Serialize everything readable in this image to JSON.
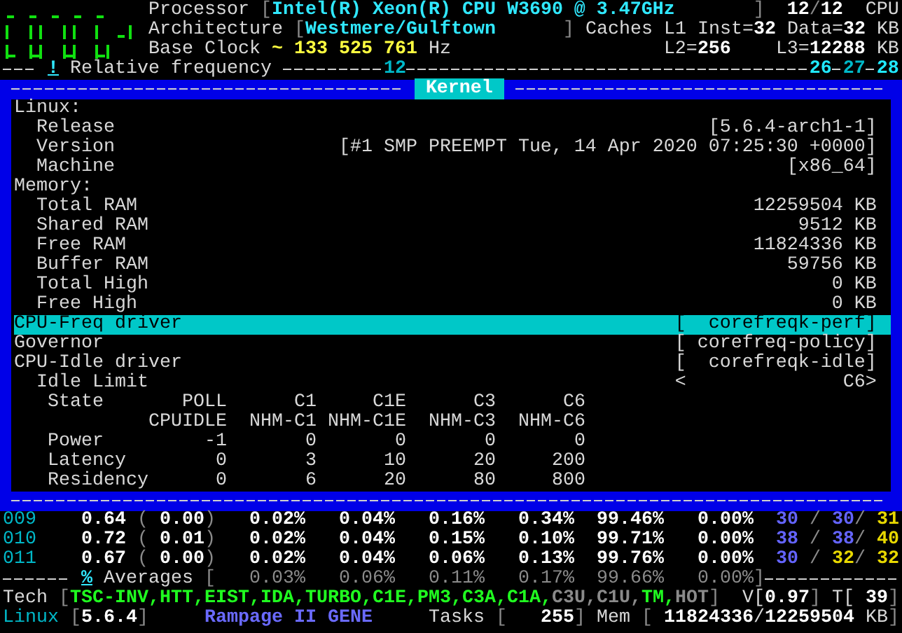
{
  "header": {
    "processor": {
      "label": "Processor",
      "open": "[",
      "value": "Intel(R) Xeon(R) CPU W3690 @ 3.47GHz",
      "close": "]",
      "online": "12",
      "separator": "/",
      "total": "12",
      "unit": "CPU"
    },
    "architecture": {
      "label": "Architecture",
      "open": "[",
      "value": "Westmere/Gulftown",
      "close": "]"
    },
    "caches": {
      "label": "Caches L1",
      "inst_label": "Inst=",
      "inst": "32",
      "data_label": "Data=",
      "data": "32",
      "unit": "KB",
      "l2_label": "L2=",
      "l2": "256",
      "l3_label": "L3=",
      "l3": "12288",
      "l3_unit": "KB"
    },
    "base_clock": {
      "label": "Base Clock",
      "symbol": "~",
      "value": "133 525 761",
      "unit": "Hz"
    },
    "ruler": {
      "symbol": "!",
      "label": "Relative frequency",
      "ticks": [
        {
          "label": "12",
          "color": "#00b8c8"
        },
        {
          "label": "26",
          "color": "#20e8ff"
        },
        {
          "label": "27",
          "color": "#00b8c8"
        },
        {
          "label": "28",
          "color": "#20e8ff"
        }
      ]
    }
  },
  "kernel": {
    "title": "Kernel",
    "rows": [
      {
        "kind": "section",
        "label": "Linux:",
        "selected": false
      },
      {
        "kind": "item",
        "label": "Release",
        "value": "[5.6.4-arch1-1]",
        "selected": false
      },
      {
        "kind": "item",
        "label": "Version",
        "value": "[#1 SMP PREEMPT Tue, 14 Apr 2020 07:25:30 +0000]",
        "selected": false
      },
      {
        "kind": "item",
        "label": "Machine",
        "value": "[x86_64]",
        "selected": false
      },
      {
        "kind": "section",
        "label": "Memory:",
        "selected": false
      },
      {
        "kind": "item",
        "label": "Total RAM",
        "value": "12259504 KB",
        "selected": false
      },
      {
        "kind": "item",
        "label": "Shared RAM",
        "value": "9512 KB",
        "selected": false
      },
      {
        "kind": "item",
        "label": "Free RAM",
        "value": "11824336 KB",
        "selected": false
      },
      {
        "kind": "item",
        "label": "Buffer RAM",
        "value": "59756 KB",
        "selected": false
      },
      {
        "kind": "item",
        "label": "Total High",
        "value": "0 KB",
        "selected": false
      },
      {
        "kind": "item",
        "label": "Free High",
        "value": "0 KB",
        "selected": false
      },
      {
        "kind": "section",
        "label": "CPU-Freq driver",
        "value": "[  corefreqk-perf]",
        "selected": true
      },
      {
        "kind": "section",
        "label": "Governor",
        "value": "[ corefreq-policy]",
        "selected": false
      },
      {
        "kind": "section",
        "label": "CPU-Idle driver",
        "value": "[  corefreqk-idle]",
        "selected": false
      },
      {
        "kind": "item",
        "label": "Idle Limit",
        "value": "<              C6>",
        "selected": false
      }
    ],
    "idle_table": {
      "state_label": "State",
      "power_label": "Power",
      "latency_label": "Latency",
      "residency_label": "Residency",
      "states": [
        {
          "name": "POLL",
          "driver": "CPUIDLE",
          "power": "-1",
          "latency": "0",
          "residency": "0"
        },
        {
          "name": "C1",
          "driver": "NHM-C1",
          "power": "0",
          "latency": "3",
          "residency": "6"
        },
        {
          "name": "C1E",
          "driver": "NHM-C1E",
          "power": "0",
          "latency": "10",
          "residency": "20"
        },
        {
          "name": "C3",
          "driver": "NHM-C3",
          "power": "0",
          "latency": "20",
          "residency": "80"
        },
        {
          "name": "C6",
          "driver": "NHM-C6",
          "power": "0",
          "latency": "200",
          "residency": "800"
        }
      ]
    }
  },
  "cores": [
    {
      "id": "009",
      "load": "0.64",
      "open": "(",
      "delta": "0.00",
      "close": ")",
      "states": [
        "0.02%",
        "0.04%",
        "0.16%",
        "0.34%",
        "99.46%",
        "0.00%"
      ],
      "temps": [
        {
          "value": "30",
          "color": "#6464ff"
        },
        {
          "value": "30",
          "color": "#6464ff"
        },
        {
          "value": "31",
          "color": "#e8d800"
        }
      ],
      "separators": [
        "/",
        "/"
      ]
    },
    {
      "id": "010",
      "load": "0.72",
      "open": "(",
      "delta": "0.01",
      "close": ")",
      "states": [
        "0.02%",
        "0.04%",
        "0.15%",
        "0.10%",
        "99.71%",
        "0.00%"
      ],
      "temps": [
        {
          "value": "38",
          "color": "#6464ff"
        },
        {
          "value": "38",
          "color": "#6464ff"
        },
        {
          "value": "40",
          "color": "#e8d800"
        }
      ],
      "separators": [
        "/",
        "/"
      ]
    },
    {
      "id": "011",
      "load": "0.67",
      "open": "(",
      "delta": "0.00",
      "close": ")",
      "states": [
        "0.02%",
        "0.04%",
        "0.06%",
        "0.13%",
        "99.76%",
        "0.00%"
      ],
      "temps": [
        {
          "value": "30",
          "color": "#6464ff"
        },
        {
          "value": "32",
          "color": "#e8d800"
        },
        {
          "value": "32",
          "color": "#e8d800"
        }
      ],
      "separators": [
        "/",
        "/"
      ]
    }
  ],
  "averages": {
    "symbol": "%",
    "label": "Averages",
    "open": "[",
    "values": [
      "0.03%",
      "0.06%",
      "0.11%",
      "0.17%",
      "99.66%",
      "0.00%"
    ],
    "close": "]"
  },
  "tech": {
    "label": "Tech",
    "open": "[",
    "flags": [
      {
        "name": "TSC-INV,",
        "on": true
      },
      {
        "name": "HTT,",
        "on": true
      },
      {
        "name": "EIST,",
        "on": true
      },
      {
        "name": "IDA,",
        "on": true
      },
      {
        "name": "TURBO,",
        "on": true
      },
      {
        "name": "C1E,",
        "on": true
      },
      {
        "name": "PM3,",
        "on": true
      },
      {
        "name": "C3A,",
        "on": true
      },
      {
        "name": "C1A,",
        "on": true
      },
      {
        "name": "C3U,",
        "on": false
      },
      {
        "name": "C1U,",
        "on": false
      },
      {
        "name": "TM,",
        "on": true
      },
      {
        "name": "HOT",
        "on": false
      }
    ],
    "close": "]",
    "voltage_label": "V[",
    "voltage": "0.97",
    "voltage_close": "]",
    "temp_label": "T[",
    "temp": "39",
    "temp_close": "]"
  },
  "status": {
    "os_label": "Linux",
    "open": "[",
    "kernel": "5.6.4",
    "close": "]",
    "board": "Rampage II GENE",
    "tasks_label": "Tasks",
    "tasks_open": "[",
    "tasks": "255",
    "tasks_close": "]",
    "mem_label": "Mem",
    "mem_open": "[",
    "mem_free": "11824336",
    "mem_sep": "/",
    "mem_total": "12259504",
    "mem_unit": "KB",
    "mem_close": "]"
  }
}
